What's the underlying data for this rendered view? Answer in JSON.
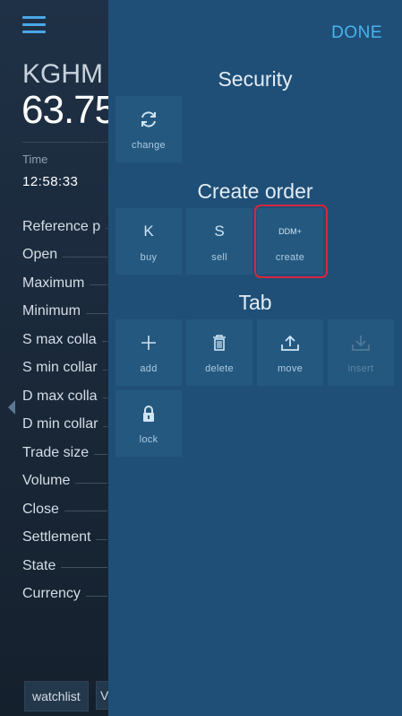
{
  "background": {
    "symbol": "KGHM",
    "price": "63.75",
    "time_label": "Time",
    "time_value": "12:58:33",
    "rows": [
      "Reference p",
      "Open",
      "Maximum",
      "Minimum",
      "S max colla",
      "S min collar",
      "D max colla",
      "D min collar",
      "Trade size",
      "Volume",
      "Close",
      "Settlement",
      "State",
      "Currency"
    ],
    "tabs": [
      "watchlist",
      "V"
    ]
  },
  "menu": {
    "done_label": "DONE",
    "sections": {
      "security": "Security",
      "create_order": "Create order",
      "tab": "Tab"
    },
    "tiles": {
      "change": {
        "label": "change",
        "icon": "refresh-icon"
      },
      "buy": {
        "label": "buy",
        "icon_text": "K"
      },
      "sell": {
        "label": "sell",
        "icon_text": "S"
      },
      "create": {
        "label": "create",
        "icon_text": "DDM+"
      },
      "add": {
        "label": "add",
        "icon": "plus-icon"
      },
      "delete": {
        "label": "delete",
        "icon": "trash-icon"
      },
      "move": {
        "label": "move",
        "icon": "upload-icon"
      },
      "insert": {
        "label": "insert",
        "icon": "download-icon"
      },
      "lock": {
        "label": "lock",
        "icon": "lock-icon"
      }
    }
  },
  "colors": {
    "accent": "#4ab3ef",
    "panel": "#1f4f77",
    "tile": "#24587f",
    "highlight": "#d8263d"
  }
}
